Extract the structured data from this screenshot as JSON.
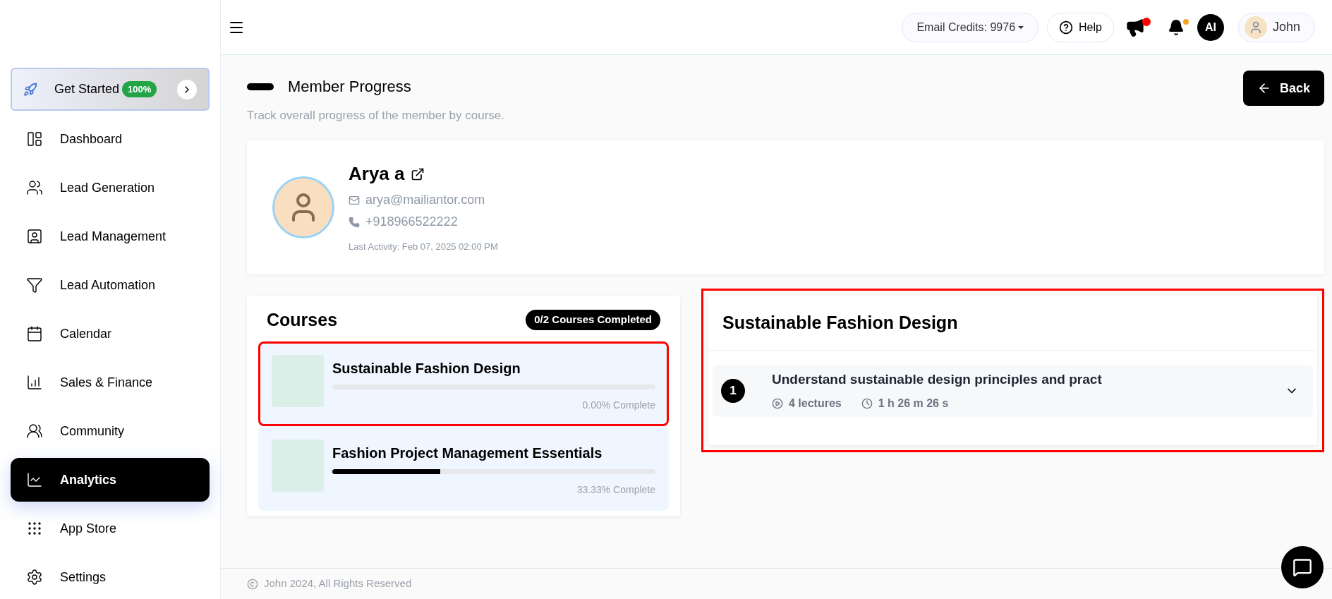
{
  "header": {
    "credits": "Email Credits: 9976",
    "help": "Help",
    "announcement_unread": true,
    "notification_unread": true,
    "ai_badge": "AI",
    "user": "John"
  },
  "sidebar": {
    "get_started": {
      "label": "Get Started",
      "badge": "100%"
    },
    "items": [
      {
        "label": "Dashboard",
        "selected": false
      },
      {
        "label": "Lead Generation",
        "selected": false
      },
      {
        "label": "Lead Management",
        "selected": false
      },
      {
        "label": "Lead Automation",
        "selected": false
      },
      {
        "label": "Calendar",
        "selected": false
      },
      {
        "label": "Sales & Finance",
        "selected": false
      },
      {
        "label": "Community",
        "selected": false
      },
      {
        "label": "Analytics",
        "selected": true
      },
      {
        "label": "App Store",
        "selected": false
      },
      {
        "label": "Settings",
        "selected": false
      }
    ]
  },
  "page": {
    "title": "Member Progress",
    "subtitle": "Track overall progress of the member by course.",
    "back": "Back"
  },
  "member": {
    "name": "Arya a",
    "email": "arya@mailiantor.com",
    "phone": "+918966522222",
    "last_activity": "Last Activity: Feb 07, 2025 02:00 PM"
  },
  "courses": {
    "title": "Courses",
    "completed": "0/2 Courses Completed",
    "items": [
      {
        "title": "Sustainable Fashion Design",
        "level": 0,
        "progress": "0.00% Complete",
        "selected": true
      },
      {
        "title": "Fashion Project Management Essentials",
        "level": 0.3333,
        "progress": "33.33% Complete",
        "selected": false
      }
    ]
  },
  "detail": {
    "title": "Sustainable Fashion Design",
    "highlighted": true,
    "sections": [
      {
        "number": "1",
        "title": "Understand sustainable design principles and pract",
        "lectures": "4 lectures",
        "duration": "1 h 26 m 26 s",
        "expanded": false
      }
    ]
  },
  "footer": {
    "copyright": "John 2024, All Rights Reserved"
  }
}
